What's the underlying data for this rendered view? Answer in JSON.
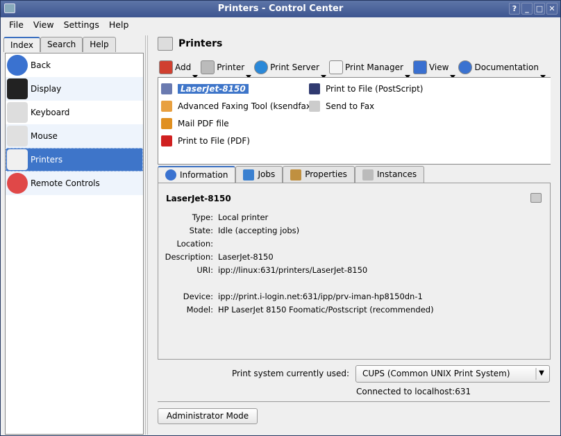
{
  "window": {
    "title": "Printers - Control Center",
    "buttons": [
      "?",
      "_",
      "□",
      "✕"
    ]
  },
  "menu": [
    "File",
    "View",
    "Settings",
    "Help"
  ],
  "left_tabs": [
    "Index",
    "Search",
    "Help"
  ],
  "sidebar": {
    "items": [
      {
        "label": "Back",
        "icon": "back-arrow-icon",
        "color": "#3a72d0"
      },
      {
        "label": "Display",
        "icon": "display-icon",
        "color": "#222222"
      },
      {
        "label": "Keyboard",
        "icon": "keyboard-icon",
        "color": "#dddddd"
      },
      {
        "label": "Mouse",
        "icon": "mouse-icon",
        "color": "#e0e0e0"
      },
      {
        "label": "Printers",
        "icon": "printer-icon",
        "color": "#f0f0f0",
        "selected": true
      },
      {
        "label": "Remote Controls",
        "icon": "remote-control-icon",
        "color": "#e04848"
      }
    ]
  },
  "header": {
    "title": "Printers"
  },
  "toolbar": [
    {
      "label": "Add",
      "icon": "wizard-wand-icon",
      "color": "#d04030"
    },
    {
      "label": "Printer",
      "icon": "printer-stack-icon",
      "color": "#bbbbbb"
    },
    {
      "label": "Print Server",
      "icon": "gear-icon",
      "color": "#2a88d8"
    },
    {
      "label": "Print Manager",
      "icon": "document-icon",
      "color": "#f4f4f4"
    },
    {
      "label": "View",
      "icon": "window-icon",
      "color": "#3a70d0"
    },
    {
      "label": "Documentation",
      "icon": "help-icon",
      "color": "#3a72d0"
    }
  ],
  "printers": [
    {
      "label": "LaserJet-8150",
      "icon": "laser-printer-icon",
      "color": "#6a7ab0",
      "selected": true
    },
    {
      "label": "Advanced Faxing Tool (ksendfax)",
      "icon": "fax-tool-icon",
      "color": "#e8a040"
    },
    {
      "label": "Mail PDF file",
      "icon": "mail-pdf-icon",
      "color": "#e09020"
    },
    {
      "label": "Print to File (PDF)",
      "icon": "pdf-icon",
      "color": "#d02020"
    },
    {
      "label": "Print to File (PostScript)",
      "icon": "floppy-icon",
      "color": "#303a70"
    },
    {
      "label": "Send to Fax",
      "icon": "fax-icon",
      "color": "#cccccc"
    }
  ],
  "tabs": [
    {
      "label": "Information",
      "icon": "info-icon",
      "color": "#3a72d0"
    },
    {
      "label": "Jobs",
      "icon": "folder-icon",
      "color": "#3a80d0"
    },
    {
      "label": "Properties",
      "icon": "wrench-icon",
      "color": "#c09040"
    },
    {
      "label": "Instances",
      "icon": "printer-icon",
      "color": "#bbbbbb"
    }
  ],
  "info": {
    "name": "LaserJet-8150",
    "rows": [
      {
        "k": "Type:",
        "v": "Local printer"
      },
      {
        "k": "State:",
        "v": "Idle (accepting jobs)"
      },
      {
        "k": "Location:",
        "v": ""
      },
      {
        "k": "Description:",
        "v": "LaserJet-8150"
      },
      {
        "k": "URI:",
        "v": "ipp://linux:631/printers/LaserJet-8150"
      },
      {
        "k": "Device:",
        "v": "ipp://print.i-login.net:631/ipp/prv-iman-hp8150dn-1"
      },
      {
        "k": "Model:",
        "v": "HP LaserJet 8150 Foomatic/Postscript (recommended)"
      }
    ]
  },
  "print_system": {
    "label": "Print system currently used:",
    "value": "CUPS (Common UNIX Print System)",
    "status": "Connected to localhost:631"
  },
  "admin_button": "Administrator Mode"
}
